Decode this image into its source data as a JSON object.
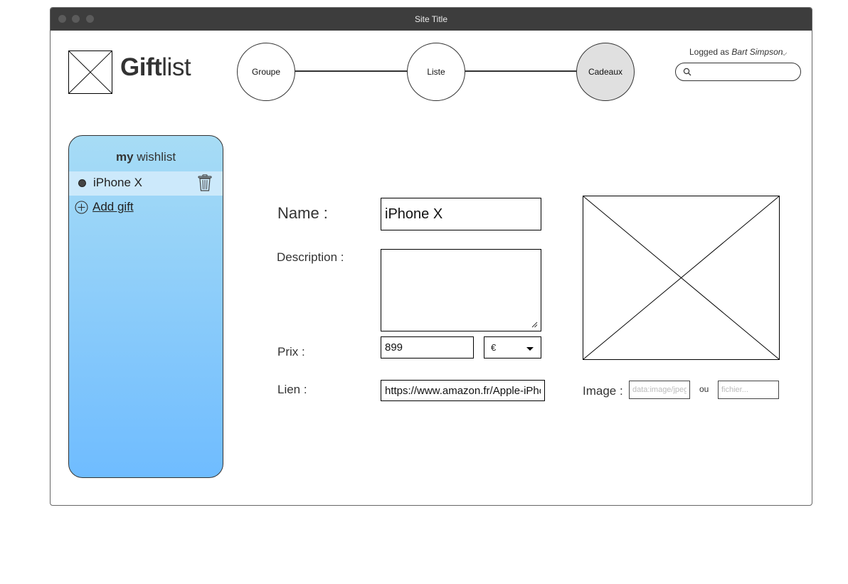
{
  "window": {
    "site_title": "Site Title"
  },
  "brand": {
    "bold": "Gift",
    "light": "list"
  },
  "stepper": {
    "steps": [
      "Groupe",
      "Liste",
      "Cadeaux"
    ]
  },
  "user": {
    "logged_as": "Logged as",
    "name": "Bart Simpson",
    "chevron": "⌵"
  },
  "search": {
    "placeholder": ""
  },
  "sidebar": {
    "title_bold": "my",
    "title_rest": " wishlist",
    "items": [
      {
        "label": "iPhone X"
      }
    ],
    "add_label": "Add gift"
  },
  "form": {
    "name_label": "Name :",
    "name_value": "iPhone X",
    "description_label": "Description :",
    "description_value": "",
    "price_label": "Prix :",
    "price_value": "899",
    "currency": "€",
    "link_label": "Lien :",
    "link_value": "https://www.amazon.fr/Apple-iPhone-X",
    "image_label": "Image :",
    "image_url_placeholder": "data:image/jpeg",
    "or_label": "ou",
    "file_placeholder": "fichier..."
  },
  "icons": {
    "logo": "image-placeholder-icon",
    "search": "search-icon",
    "trash": "trash-icon",
    "add": "plus-circle-icon",
    "image": "image-placeholder-icon",
    "caret": "caret-down-icon",
    "resize": "resize-grip-icon"
  }
}
